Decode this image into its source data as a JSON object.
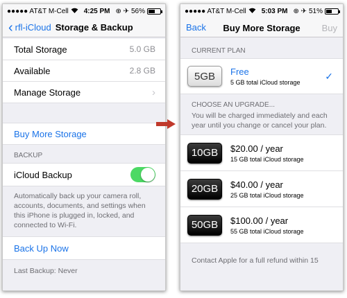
{
  "left": {
    "status": {
      "carrier": "●●●●● AT&T M-Cell",
      "wifi": "wifi-icon",
      "time": "4:25 PM",
      "icons": "⊕ ✈",
      "battery": "56%",
      "battery_level": 56
    },
    "nav": {
      "back": "rfl-iCloud",
      "title": "Storage & Backup"
    },
    "storage": [
      {
        "label": "Total Storage",
        "value": "5.0 GB"
      },
      {
        "label": "Available",
        "value": "2.8 GB"
      }
    ],
    "manage_storage": "Manage Storage",
    "buy_more": "Buy More Storage",
    "backup_header": "BACKUP",
    "icloud_backup": "iCloud Backup",
    "backup_note": "Automatically back up your camera roll, accounts, documents, and settings when this iPhone is plugged in, locked, and connected to Wi-Fi.",
    "back_up_now": "Back Up Now",
    "last_backup": "Last Backup: Never"
  },
  "right": {
    "status": {
      "carrier": "●●●●● AT&T M-Cell",
      "wifi": "wifi-icon",
      "time": "5:03 PM",
      "icons": "⊕ ✈",
      "battery": "51%",
      "battery_level": 51
    },
    "nav": {
      "back": "Back",
      "title": "Buy More Storage",
      "action": "Buy"
    },
    "current_header": "CURRENT PLAN",
    "current": {
      "badge": "5GB",
      "name": "Free",
      "sub": "5 GB total iCloud storage"
    },
    "upgrade_header": "CHOOSE AN UPGRADE...",
    "upgrade_note": "You will be charged immediately and each year until you change or cancel your plan.",
    "upgrades": [
      {
        "badge": "10GB",
        "price": "$20.00 / year",
        "sub": "15 GB total iCloud storage"
      },
      {
        "badge": "20GB",
        "price": "$40.00 / year",
        "sub": "25 GB total iCloud storage"
      },
      {
        "badge": "50GB",
        "price": "$100.00 / year",
        "sub": "55 GB total iCloud storage"
      }
    ],
    "contact_note": "Contact Apple for a full refund within 15"
  },
  "colors": {
    "accent": "#1a73e8",
    "toggle_on": "#4cd964",
    "arrow": "#c0392b"
  }
}
